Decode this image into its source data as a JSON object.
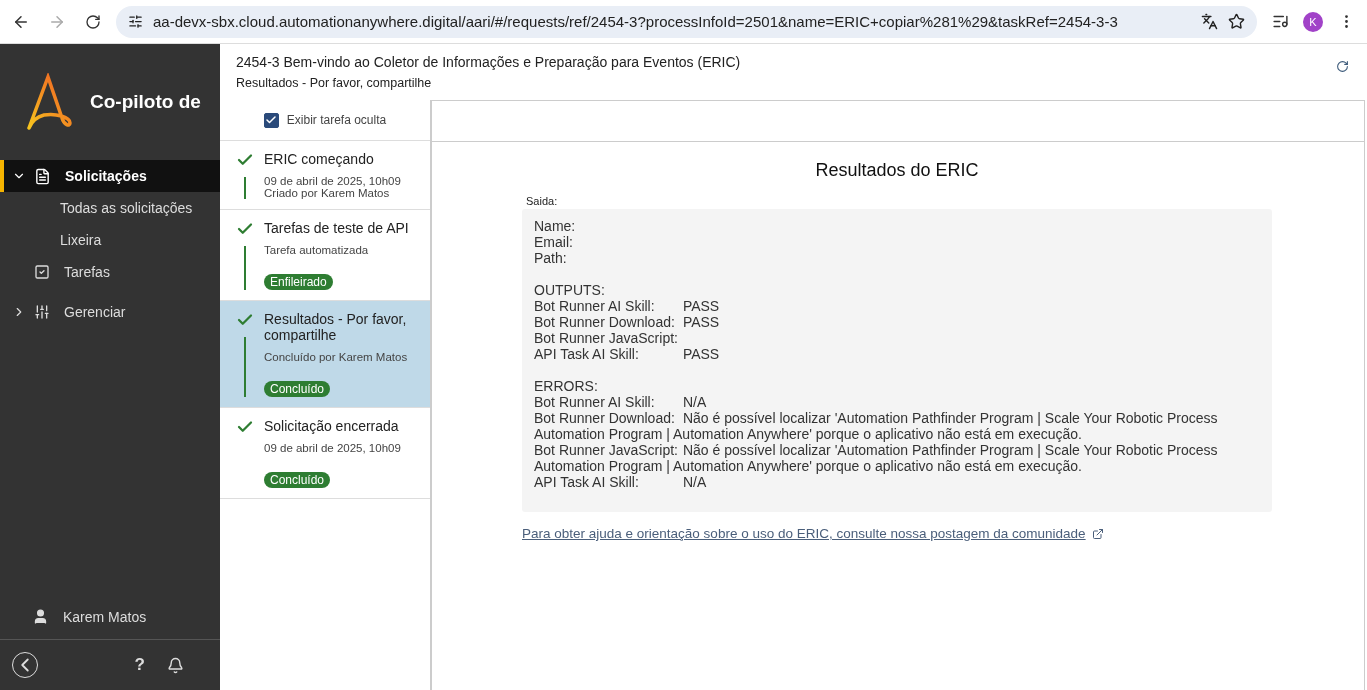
{
  "browser": {
    "url": "aa-devx-sbx.cloud.automationanywhere.digital/aari/#/requests/ref/2454-3?processInfoId=2501&name=ERIC+copiar%281%29&taskRef=2454-3-3",
    "profile_initial": "K"
  },
  "sidebar": {
    "brand": "Co-piloto de",
    "items": [
      {
        "label": "Solicitações",
        "kind": "request",
        "selected": true,
        "expanded": true,
        "children": [
          {
            "label": "Todas as solicitações"
          },
          {
            "label": "Lixeira"
          }
        ]
      },
      {
        "label": "Tarefas",
        "kind": "task",
        "selected": false
      },
      {
        "label": "Gerenciar",
        "kind": "manage",
        "selected": false,
        "expanded": false
      }
    ],
    "user": "Karem Matos",
    "help": "?"
  },
  "header": {
    "title": "2454-3 Bem-vindo ao Coletor de Informações e Preparação para Eventos (ERIC)",
    "subtitle": "Resultados - Por favor, compartilhe"
  },
  "show_hidden": {
    "label": "Exibir tarefa oculta",
    "checked": true
  },
  "timeline": [
    {
      "title": "ERIC começando",
      "lines": [
        "09 de abril de 2025, 10h09",
        "Criado por Karem Matos"
      ],
      "selected": false
    },
    {
      "title": "Tarefas de teste de API",
      "lines": [
        "Tarefa automatizada"
      ],
      "status": "Enfileirado",
      "selected": false
    },
    {
      "title": "Resultados - Por favor, compartilhe",
      "lines": [
        "Concluído por Karem Matos"
      ],
      "status": "Concluído",
      "selected": true
    },
    {
      "title": "Solicitação encerrada",
      "lines": [
        "09 de abril de 2025, 10h09"
      ],
      "status": "Concluído",
      "selected": false
    }
  ],
  "results": {
    "title": "Resultados do ERIC",
    "output_label": "Saida:",
    "sections": [
      [
        {
          "label": "Name:"
        },
        {
          "label": "Email:"
        },
        {
          "label": "Path:"
        }
      ],
      [
        {
          "label": "OUTPUTS:"
        },
        {
          "label": "Bot Runner AI Skill:",
          "value": "PASS"
        },
        {
          "label": "Bot Runner Download:",
          "value": "PASS"
        },
        {
          "label": "Bot Runner JavaScript:"
        },
        {
          "label": "API Task AI Skill:",
          "value": "PASS"
        }
      ],
      [
        {
          "label": "ERRORS:"
        },
        {
          "label": "Bot Runner AI Skill:",
          "value": "N/A"
        },
        {
          "label": "Bot Runner Download:",
          "value": "Não é possível localizar 'Automation Pathfinder Program | Scale Your Robotic Process Automation Program | Automation Anywhere' porque o aplicativo não está em execução."
        },
        {
          "label": "Bot Runner JavaScript:",
          "value": "Não é possível localizar 'Automation Pathfinder Program | Scale Your Robotic Process Automation Program | Automation Anywhere' porque o aplicativo não está em execução."
        },
        {
          "label": "API Task AI Skill:",
          "value": "N/A"
        }
      ]
    ],
    "help_link": "Para obter ajuda e orientação sobre o uso do ERIC, consulte nossa postagem da comunidade"
  }
}
